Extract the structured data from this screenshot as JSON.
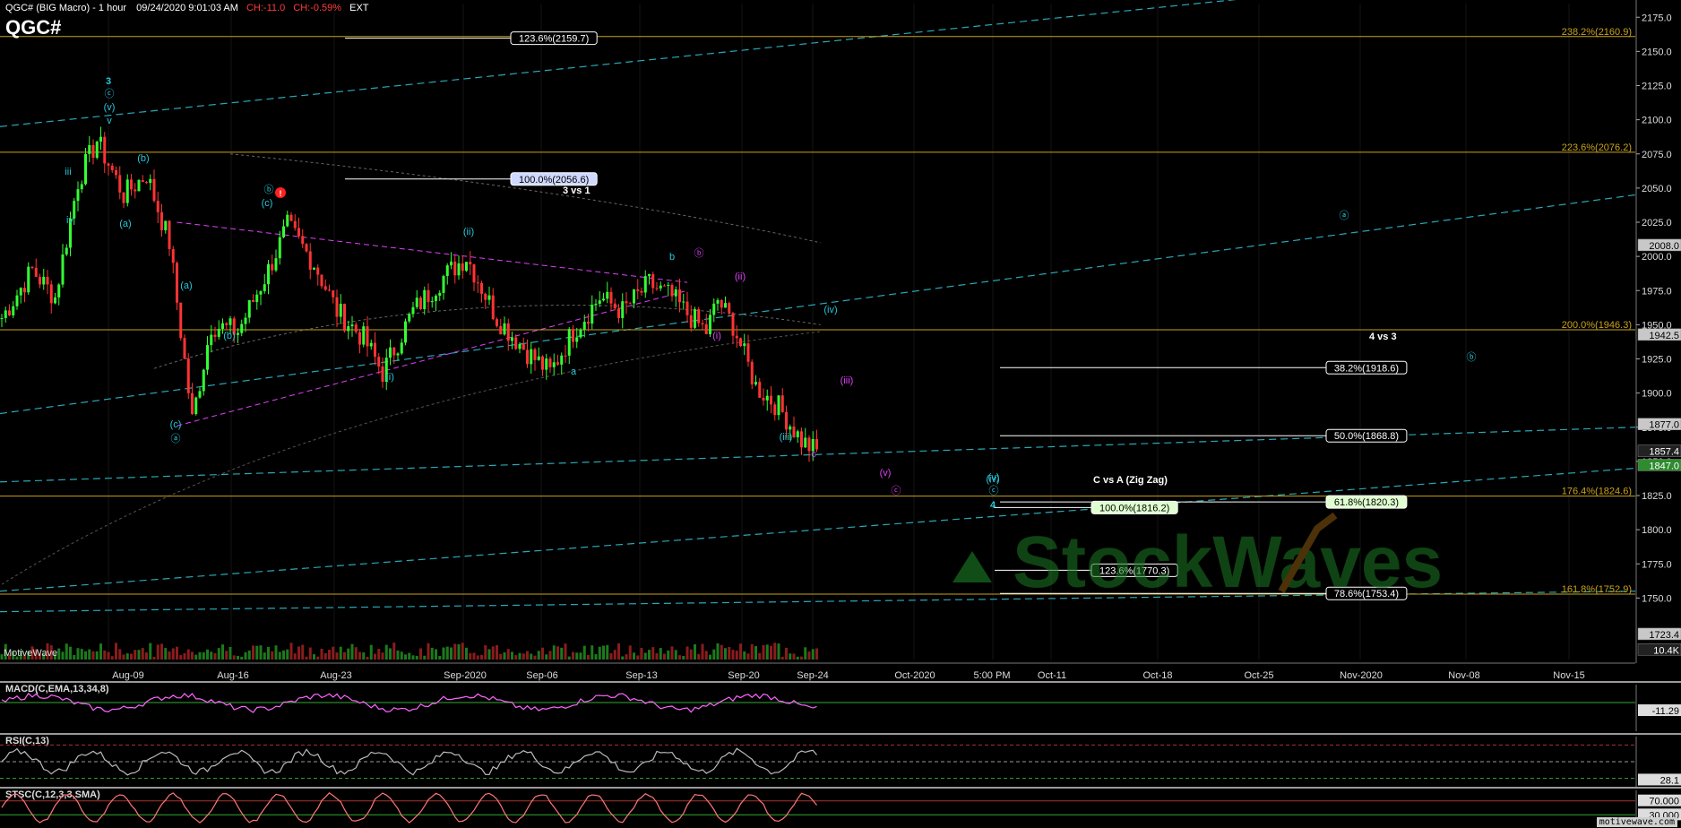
{
  "header": {
    "symbol_line": "QGC# (BIG Macro) - 1 hour",
    "datetime": "09/24/2020 9:01:03 AM",
    "change": "CH:-11.0",
    "change_pct": "CH:-0.59%",
    "session": "EXT",
    "big_symbol": "QGC#"
  },
  "watermark": "MotiveWave",
  "credit": "motivewave.com",
  "logo_text": "StockWaves",
  "colors": {
    "background": "#000000",
    "up_candle": "#33ff33",
    "down_candle": "#ff3333",
    "fib_line": "#c9a21a",
    "wave_label": "#26c6da",
    "magenta": "#e040fb",
    "trend_channel": "#2aa7b8"
  },
  "chart_data": {
    "type": "candlestick",
    "ylim": [
      1705,
      2185
    ],
    "y_ticks": [
      1750,
      1775,
      1800,
      1825,
      1850,
      1875,
      1900,
      1925,
      1950,
      1975,
      2000,
      2025,
      2050,
      2075,
      2100,
      2125,
      2150,
      2175
    ],
    "x_ticks": [
      "Aug-09",
      "Aug-16",
      "Aug-23",
      "Sep-2020",
      "Sep-06",
      "Sep-13",
      "Sep-20",
      "Sep-24",
      "Oct-2020",
      "5:00 PM",
      "Oct-11",
      "Oct-18",
      "Oct-25",
      "Nov-2020",
      "Nov-08",
      "Nov-15"
    ],
    "price_path": [
      [
        0,
        1955
      ],
      [
        8,
        1990
      ],
      [
        14,
        1970
      ],
      [
        20,
        2055
      ],
      [
        25,
        2085
      ],
      [
        32,
        2045
      ],
      [
        38,
        2060
      ],
      [
        44,
        2010
      ],
      [
        50,
        1880
      ],
      [
        55,
        1950
      ],
      [
        62,
        1945
      ],
      [
        70,
        1990
      ],
      [
        75,
        2022
      ],
      [
        82,
        1995
      ],
      [
        88,
        1960
      ],
      [
        95,
        1940
      ],
      [
        100,
        1915
      ],
      [
        108,
        1960
      ],
      [
        116,
        1985
      ],
      [
        122,
        2000
      ],
      [
        130,
        1955
      ],
      [
        138,
        1930
      ],
      [
        144,
        1915
      ],
      [
        150,
        1945
      ],
      [
        157,
        1970
      ],
      [
        163,
        1960
      ],
      [
        170,
        1980
      ],
      [
        176,
        1970
      ],
      [
        180,
        1958
      ],
      [
        185,
        1945
      ],
      [
        188,
        1968
      ],
      [
        192,
        1950
      ],
      [
        198,
        1905
      ],
      [
        204,
        1890
      ],
      [
        210,
        1865
      ],
      [
        214,
        1857
      ]
    ],
    "axis_badges": [
      {
        "value": 2008.0,
        "label": "2008.0",
        "style": "gray"
      },
      {
        "value": 1942.5,
        "label": "1942.5",
        "style": "gray"
      },
      {
        "value": 1877.0,
        "label": "1877.0",
        "style": "gray"
      },
      {
        "value": 1857.4,
        "label": "1857.4",
        "style": "dark"
      },
      {
        "value": 1847.0,
        "label": "1847.0",
        "style": "green"
      },
      {
        "value": 1723.4,
        "label": "1723.4",
        "style": "gray"
      },
      {
        "value": 1712.0,
        "label": "10.4K",
        "style": "dark"
      }
    ],
    "horizontal_levels": [
      {
        "value": 2160.9,
        "label": "238.2%(2160.9)"
      },
      {
        "value": 2076.2,
        "label": "223.6%(2076.2)"
      },
      {
        "value": 1946.3,
        "label": "200.0%(1946.3)"
      },
      {
        "value": 1824.6,
        "label": "176.4%(1824.6)"
      },
      {
        "value": 1752.9,
        "label": "161.8%(1752.9)"
      }
    ],
    "fib_boxes": [
      {
        "value": 2159.7,
        "label": "123.6%(2159.7)"
      },
      {
        "value": 2056.6,
        "label": "100.0%(2056.6)"
      },
      {
        "value": 1918.6,
        "label": "38.2%(1918.6)"
      },
      {
        "value": 1868.8,
        "label": "50.0%(1868.8)"
      },
      {
        "value": 1820.3,
        "label": "61.8%(1820.3)"
      },
      {
        "value": 1816.2,
        "label": "100.0%(1816.2)"
      },
      {
        "value": 1770.3,
        "label": "123.6%(1770.3)"
      },
      {
        "value": 1753.4,
        "label": "78.6%(1753.4)"
      }
    ],
    "annotations": [
      "3 vs 1",
      "4 vs 3",
      "C vs A (Zig Zag)"
    ],
    "wave_labels": [
      "3",
      "ⓒ",
      "(v)",
      "v",
      "iii",
      "iv",
      "(b)",
      "(a)",
      "ⓑ",
      "(c)",
      "(a)",
      "(b)",
      "(c)",
      "ⓐ",
      "(i)",
      "(ii)",
      "b",
      "a",
      "ⓑ",
      "(ii)",
      "(i)",
      "(iii)",
      "c",
      "(iii)",
      "(iv)",
      "(iv)",
      "(v)",
      "ⓒ",
      "(v)",
      "ⓒ",
      "4",
      "ⓐ",
      "ⓑ"
    ],
    "panels": [
      {
        "name": "MACD(C,EMA,13,34,8)",
        "value_label": "-11.29",
        "ylim": [
          -40,
          25
        ],
        "ref": 0
      },
      {
        "name": "RSI(C,13)",
        "value_label": "28.1",
        "ylim": [
          20,
          80
        ],
        "ref_levels": [
          70,
          50,
          30
        ]
      },
      {
        "name": "STSC(C,12,3,3,SMA)",
        "value_labels": [
          "70.000",
          "30.000"
        ],
        "ylim": [
          0,
          100
        ],
        "ref_levels": [
          70,
          30
        ]
      }
    ]
  }
}
